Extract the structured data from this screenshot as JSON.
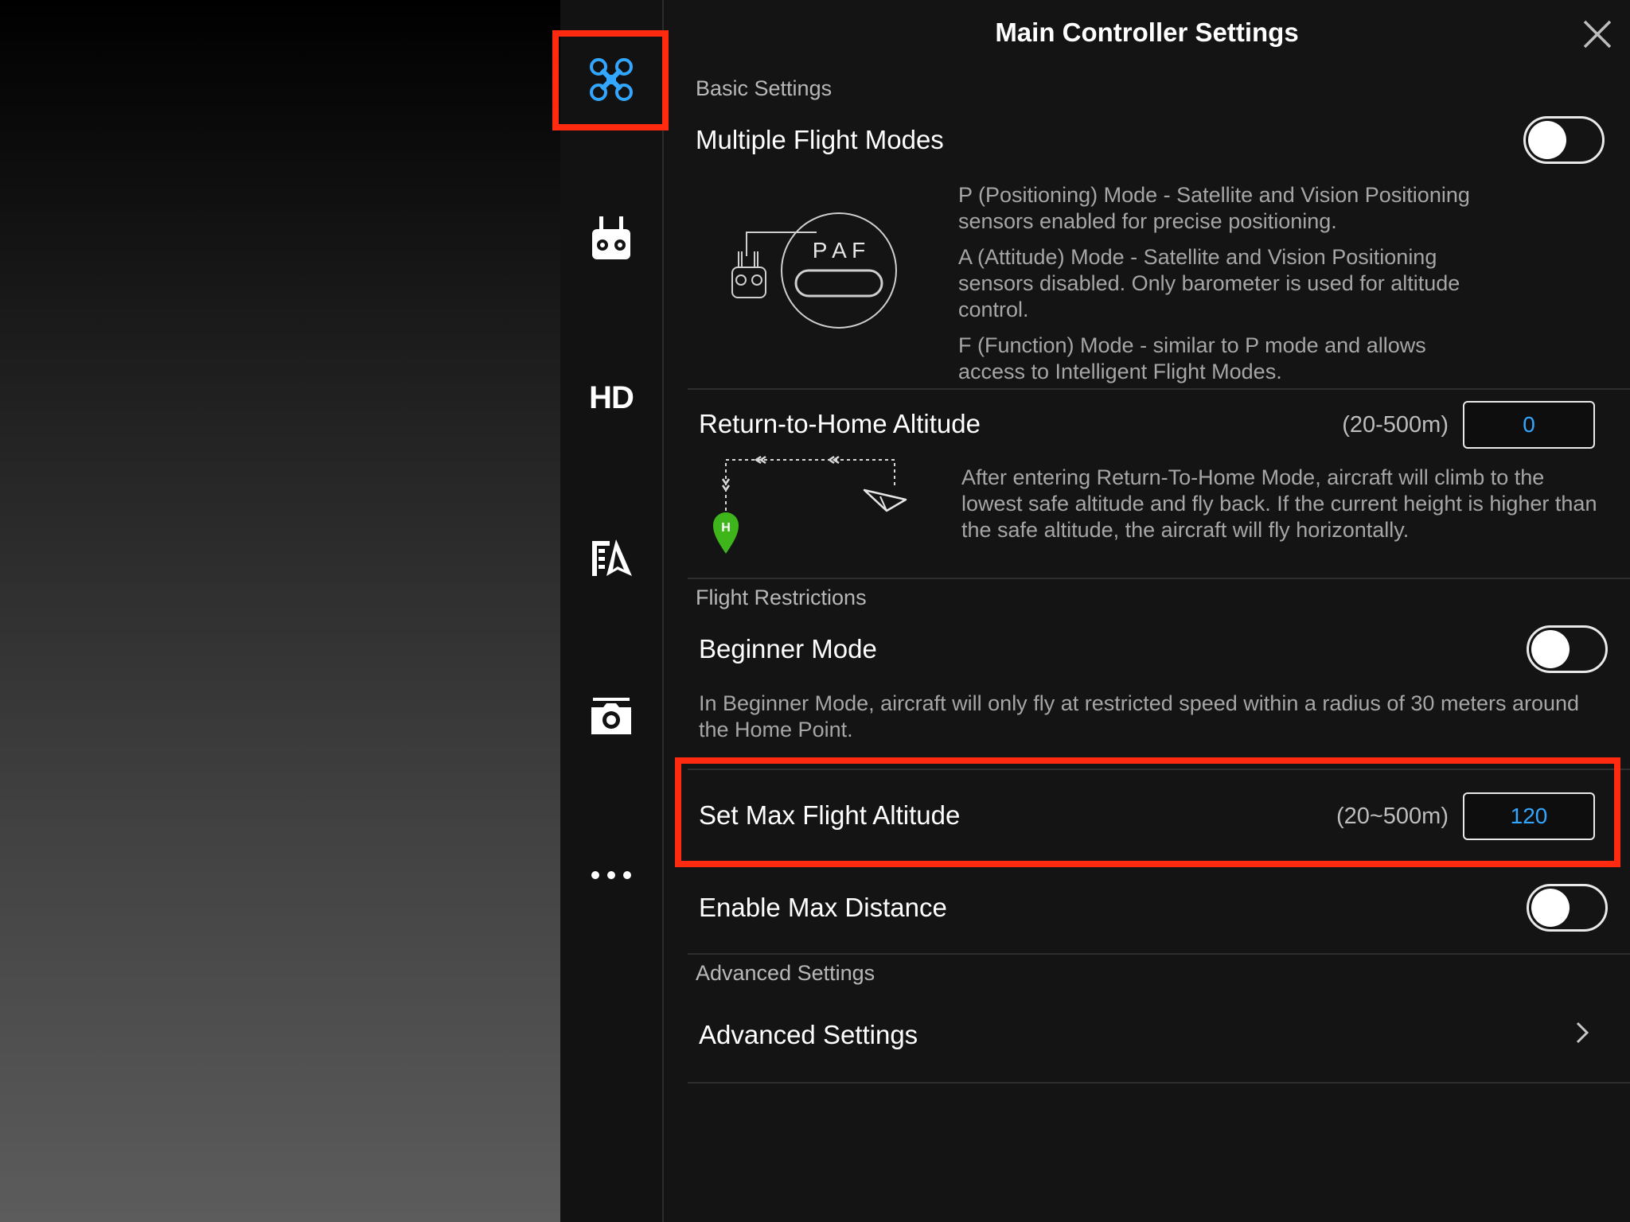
{
  "panel": {
    "title": "Main Controller Settings"
  },
  "sidebar": {
    "items": [
      {
        "name": "aircraft",
        "icon": "aircraft-icon",
        "active": true
      },
      {
        "name": "remote-controller",
        "icon": "remote-controller-icon"
      },
      {
        "name": "hd",
        "label": "HD"
      },
      {
        "name": "battery",
        "icon": "battery-icon"
      },
      {
        "name": "camera",
        "icon": "camera-icon"
      },
      {
        "name": "more",
        "icon": "more-icon"
      }
    ]
  },
  "basic": {
    "section_label": "Basic Settings",
    "multiple_flight_modes": {
      "label": "Multiple Flight Modes",
      "enabled": false,
      "mode_letters": "P A F",
      "descriptions": [
        "P (Positioning) Mode - Satellite and Vision Positioning sensors enabled for precise positioning.",
        "A (Attitude) Mode - Satellite and Vision Positioning sensors disabled. Only barometer is used for altitude control.",
        "F (Function) Mode - similar to P mode and allows access to Intelligent Flight Modes."
      ]
    },
    "rth_altitude": {
      "label": "Return-to-Home Altitude",
      "range": "(20-500m)",
      "value": "0",
      "home_marker": "H",
      "description": "After entering Return-To-Home Mode, aircraft will climb to the lowest safe altitude and fly back. If the current height is higher than the safe altitude, the aircraft will fly horizontally."
    }
  },
  "restrictions": {
    "section_label": "Flight Restrictions",
    "beginner_mode": {
      "label": "Beginner Mode",
      "enabled": false,
      "description": "In Beginner Mode, aircraft will only fly at restricted speed within a radius of 30 meters around the Home Point."
    },
    "max_altitude": {
      "label": "Set Max Flight Altitude",
      "range": "(20~500m)",
      "value": "120"
    },
    "max_distance": {
      "label": "Enable Max Distance",
      "enabled": false
    }
  },
  "advanced": {
    "section_label": "Advanced Settings",
    "item_label": "Advanced Settings"
  },
  "colors": {
    "accent": "#33a7ff",
    "highlight": "#ff2a10",
    "home_marker": "#3fb51c"
  }
}
